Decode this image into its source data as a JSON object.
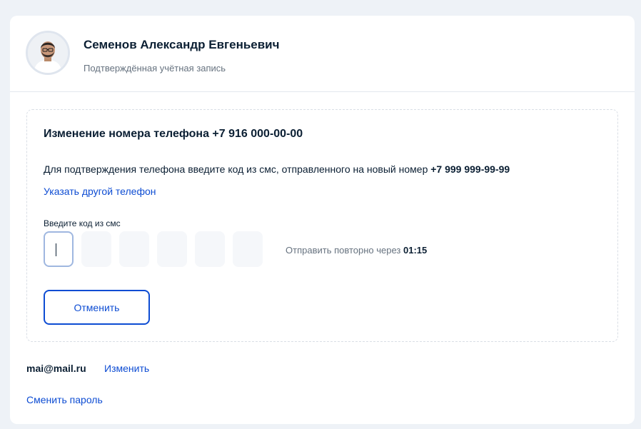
{
  "profile": {
    "name": "Семенов Александр Евгеньевич",
    "status": "Подтверждённая учётная запись",
    "avatar_icon": "user-photo-icon"
  },
  "phone_change": {
    "title": "Изменение номера телефона +7 916 000-00-00",
    "info_text": "Для подтверждения телефона введите код из смс, отправленного на новый номер ",
    "new_number": "+7 999 999-99-99",
    "change_link": "Указать другой телефон",
    "code_label": "Введите код из смс",
    "code_digits": [
      "",
      "",
      "",
      "",
      "",
      ""
    ],
    "resend_text": "Отправить повторно через ",
    "resend_timer": "01:15",
    "cancel_label": "Отменить"
  },
  "email": {
    "value": "mai@mail.ru",
    "change_label": "Изменить"
  },
  "password": {
    "change_label": "Сменить пароль"
  },
  "colors": {
    "link": "#0d4cd3",
    "text": "#0b1f33",
    "muted": "#66727f",
    "background": "#eef2f7"
  }
}
